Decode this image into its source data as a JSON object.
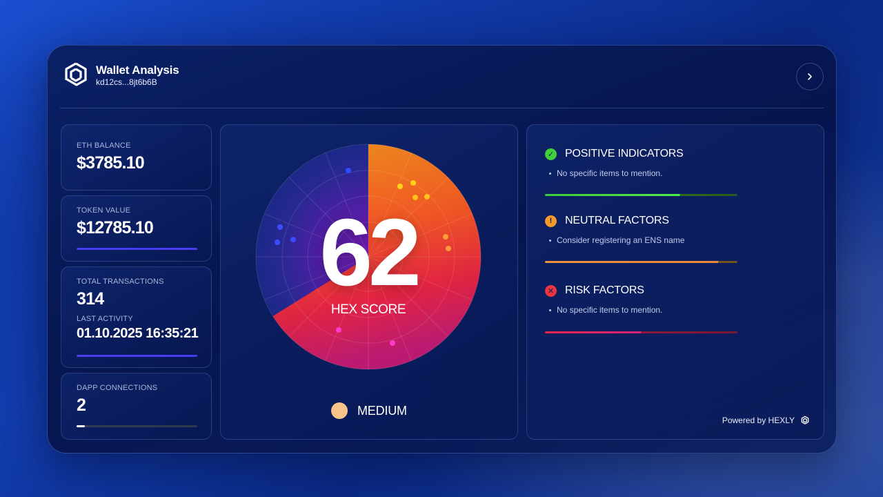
{
  "header": {
    "title": "Wallet Analysis",
    "address": "kd12cs...8jt6b6B"
  },
  "stats": {
    "eth_balance": {
      "label": "ETH BALANCE",
      "value": "$3785.10"
    },
    "token_value": {
      "label": "TOKEN VALUE",
      "value": "$12785.10"
    },
    "total_transactions": {
      "label": "TOTAL TRANSACTIONS",
      "value": "314"
    },
    "last_activity": {
      "label": "LAST ACTIVITY",
      "value": "01.10.2025 16:35:21"
    },
    "dapp_connections": {
      "label": "DAPP CONNECTIONS",
      "value": "2"
    }
  },
  "score": {
    "value": "62",
    "label": "HEX SCORE",
    "level": "MEDIUM",
    "level_color": "#f9c48a"
  },
  "indicators": [
    {
      "title": "POSITIVE INDICATORS",
      "note": "No specific items to mention.",
      "icon": "check-icon",
      "color": "#3ecf3a"
    },
    {
      "title": "NEUTRAL FACTORS",
      "note": "Consider registering an ENS name",
      "icon": "exclamation-icon",
      "color": "#f59a2a"
    },
    {
      "title": "RISK FACTORS",
      "note": "No specific items to mention.",
      "icon": "x-icon",
      "color": "#e8353f"
    }
  ],
  "footer": {
    "powered_by": "Powered by HEXLY"
  },
  "colors": {
    "accent": "#4a3cf0",
    "background": "#0b2a86"
  }
}
